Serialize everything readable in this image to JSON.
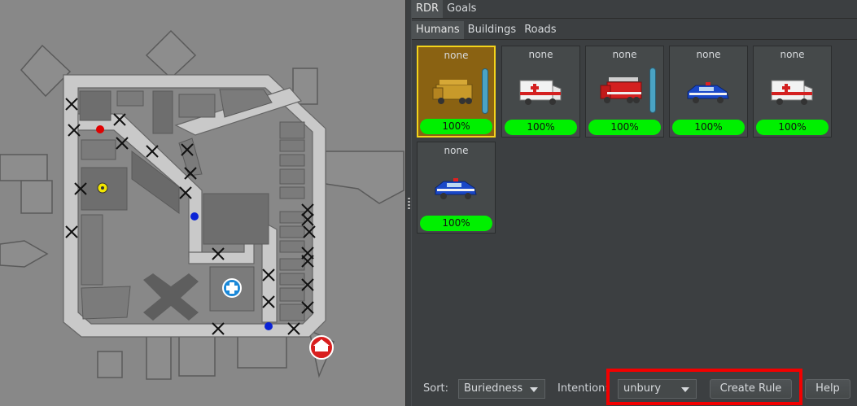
{
  "tabs_top": [
    {
      "label": "RDR",
      "active": true
    },
    {
      "label": "Goals",
      "active": false
    }
  ],
  "tabs_sub": [
    {
      "label": "Humans",
      "active": true
    },
    {
      "label": "Buildings",
      "active": false
    },
    {
      "label": "Roads",
      "active": false
    }
  ],
  "agents": [
    {
      "caption": "none",
      "health": "100%",
      "vehicle": "fire-truck-icon",
      "selected": true,
      "has_water_gauge": true
    },
    {
      "caption": "none",
      "health": "100%",
      "vehicle": "ambulance-icon",
      "selected": false,
      "has_water_gauge": false
    },
    {
      "caption": "none",
      "health": "100%",
      "vehicle": "fire-truck-icon",
      "selected": false,
      "has_water_gauge": true
    },
    {
      "caption": "none",
      "health": "100%",
      "vehicle": "police-car-icon",
      "selected": false,
      "has_water_gauge": false
    },
    {
      "caption": "none",
      "health": "100%",
      "vehicle": "ambulance-icon",
      "selected": false,
      "has_water_gauge": false
    },
    {
      "caption": "none",
      "health": "100%",
      "vehicle": "police-car-icon",
      "selected": false,
      "has_water_gauge": false
    }
  ],
  "bottom": {
    "sort_label": "Sort:",
    "sort_value": "Buriedness",
    "intention_label": "Intention:",
    "intention_value": "unbury",
    "create_rule_label": "Create Rule",
    "help_label": "Help"
  },
  "colors": {
    "health_bar": "#00f000",
    "selected_border": "#f4d31a",
    "highlight": "#f20000",
    "map_background": "#888888"
  }
}
